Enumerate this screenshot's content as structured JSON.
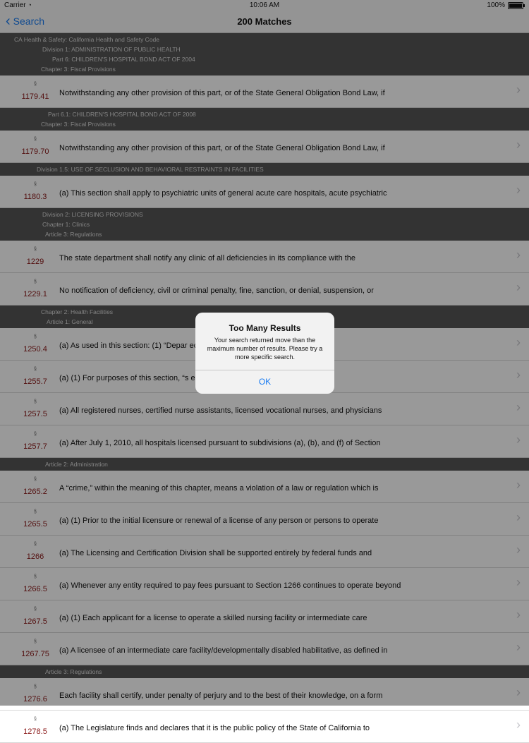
{
  "status": {
    "carrier": "Carrier",
    "time": "10:06 AM",
    "battery": "100%"
  },
  "nav": {
    "back_label": "Search",
    "title": "200 Matches"
  },
  "sections": [
    {
      "header": [
        "CA Health & Safety: California Health and Safety Code",
        "Division 1: ADMINISTRATION OF PUBLIC HEALTH",
        "Part 6: CHILDREN'S HOSPITAL BOND ACT OF 2004",
        "Chapter 3: Fiscal Provisions"
      ],
      "header_indent": [
        20,
        60,
        74,
        58
      ],
      "rows": [
        {
          "section": "1179.41",
          "text": "Notwithstanding any other provision of this part, or of the State General Obligation Bond Law, if"
        }
      ]
    },
    {
      "header": [
        "Part 6.1: CHILDREN'S HOSPITAL BOND ACT OF 2008",
        "Chapter 3: Fiscal Provisions"
      ],
      "header_indent": [
        68,
        58
      ],
      "rows": [
        {
          "section": "1179.70",
          "text": "Notwithstanding any other provision of this part, or of the State General Obligation Bond Law, if"
        }
      ]
    },
    {
      "header": [
        "Division 1.5: USE OF SECLUSION AND BEHAVIORAL RESTRAINTS IN FACILITIES"
      ],
      "header_indent": [
        52
      ],
      "rows": [
        {
          "section": "1180.3",
          "text": "(a) This section shall apply to psychiatric units of general acute care hospitals, acute psychiatric"
        }
      ]
    },
    {
      "header": [
        "Division 2: LICENSING PROVISIONS",
        "Chapter 1: Clinics",
        "Article 3: Regulations"
      ],
      "header_indent": [
        60,
        60,
        64
      ],
      "rows": [
        {
          "section": "1229",
          "text": "The state department shall notify any clinic of all deficiencies in its compliance with the"
        },
        {
          "section": "1229.1",
          "text": "No notification of deficiency, civil or criminal penalty, fine, sanction, or denial, suspension, or"
        }
      ]
    },
    {
      "header": [
        "Chapter 2: Health Facilities",
        "Article 1: General"
      ],
      "header_indent": [
        58,
        66
      ],
      "rows": [
        {
          "section": "1250.4",
          "text": "(a) As used in this section: (1) “Depar                                          ections or the Department"
        },
        {
          "section": "1255.7",
          "text": "(a) (1) For purposes of this section, “s                                           e following:(A) A"
        },
        {
          "section": "1257.5",
          "text": "(a) All registered nurses, certified nurse assistants, licensed vocational nurses, and physicians"
        },
        {
          "section": "1257.7",
          "text": "(a) After July 1, 2010, all hospitals licensed pursuant to subdivisions (a), (b), and (f) of Section"
        }
      ]
    },
    {
      "header": [
        "Article 2: Administration"
      ],
      "header_indent": [
        64
      ],
      "rows": [
        {
          "section": "1265.2",
          "text": "A “crime,” within the meaning of this chapter, means a violation of a law or regulation which is"
        },
        {
          "section": "1265.5",
          "text": "(a) (1) Prior to the initial licensure or renewal of a license of any person or persons to operate"
        },
        {
          "section": "1266",
          "text": "(a) The Licensing and Certification Division shall be supported entirely by federal funds and"
        },
        {
          "section": "1266.5",
          "text": "(a) Whenever any entity required to pay fees pursuant to Section 1266 continues to operate beyond"
        },
        {
          "section": "1267.5",
          "text": "(a) (1) Each applicant for a license to operate a skilled nursing facility or intermediate care"
        },
        {
          "section": "1267.75",
          "text": "(a) A licensee of an intermediate care facility/developmentally disabled habilitative, as defined in"
        }
      ]
    },
    {
      "header": [
        "Article 3: Regulations"
      ],
      "header_indent": [
        64
      ],
      "rows": [
        {
          "section": "1276.6",
          "text": "Each facility shall certify, under penalty of perjury and to the best of their knowledge, on a form"
        },
        {
          "section": "1278.5",
          "text": "(a) The Legislature finds and declares that it is the public policy of the State of California to"
        }
      ]
    }
  ],
  "alert": {
    "title": "Too Many Results",
    "message": "Your search returned move than the maximum number of results. Please try a more specific search.",
    "button": "OK"
  }
}
